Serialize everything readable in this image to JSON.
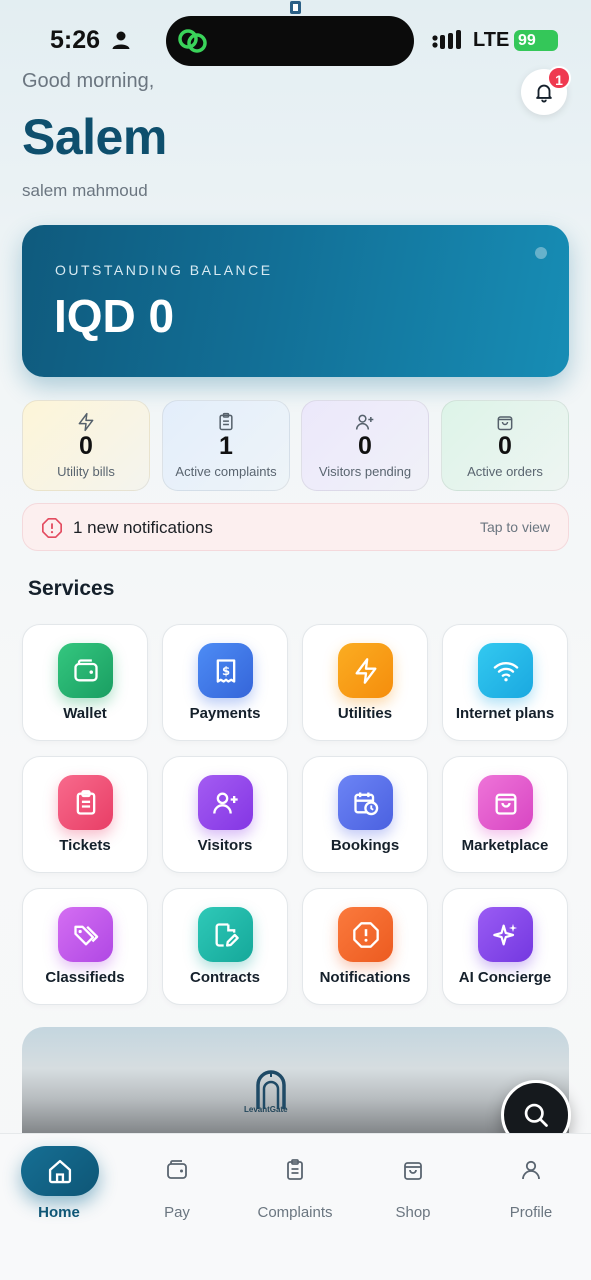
{
  "status_bar": {
    "time": "5:26",
    "network": "LTE",
    "battery": "99"
  },
  "header": {
    "greeting": "Good morning,",
    "name": "Salem",
    "full_name": "salem mahmoud",
    "notification_count": "1"
  },
  "balance": {
    "label": "OUTSTANDING BALANCE",
    "value": "IQD 0"
  },
  "stats": [
    {
      "value": "0",
      "label": "Utility bills",
      "icon": "lightning-icon"
    },
    {
      "value": "1",
      "label": "Active complaints",
      "icon": "clipboard-icon"
    },
    {
      "value": "0",
      "label": "Visitors pending",
      "icon": "user-plus-icon"
    },
    {
      "value": "0",
      "label": "Active orders",
      "icon": "bag-icon"
    }
  ],
  "notification_banner": {
    "text": "1 new notifications",
    "cta": "Tap to view"
  },
  "services": {
    "title": "Services",
    "items": [
      {
        "label": "Wallet",
        "icon": "wallet-icon"
      },
      {
        "label": "Payments",
        "icon": "receipt-icon"
      },
      {
        "label": "Utilities",
        "icon": "lightning-icon"
      },
      {
        "label": "Internet plans",
        "icon": "wifi-icon"
      },
      {
        "label": "Tickets",
        "icon": "clipboard-icon"
      },
      {
        "label": "Visitors",
        "icon": "user-plus-icon"
      },
      {
        "label": "Bookings",
        "icon": "calendar-clock-icon"
      },
      {
        "label": "Marketplace",
        "icon": "bag-icon"
      },
      {
        "label": "Classifieds",
        "icon": "tags-icon"
      },
      {
        "label": "Contracts",
        "icon": "document-edit-icon"
      },
      {
        "label": "Notifications",
        "icon": "alert-octagon-icon"
      },
      {
        "label": "AI Concierge",
        "icon": "sparkles-icon"
      }
    ]
  },
  "promo": {
    "brand": "LevantGate"
  },
  "bottom_nav": {
    "items": [
      {
        "label": "Home",
        "icon": "home-icon",
        "active": true
      },
      {
        "label": "Pay",
        "icon": "wallet-icon"
      },
      {
        "label": "Complaints",
        "icon": "clipboard-icon"
      },
      {
        "label": "Shop",
        "icon": "bag-icon"
      },
      {
        "label": "Profile",
        "icon": "user-icon"
      }
    ]
  }
}
